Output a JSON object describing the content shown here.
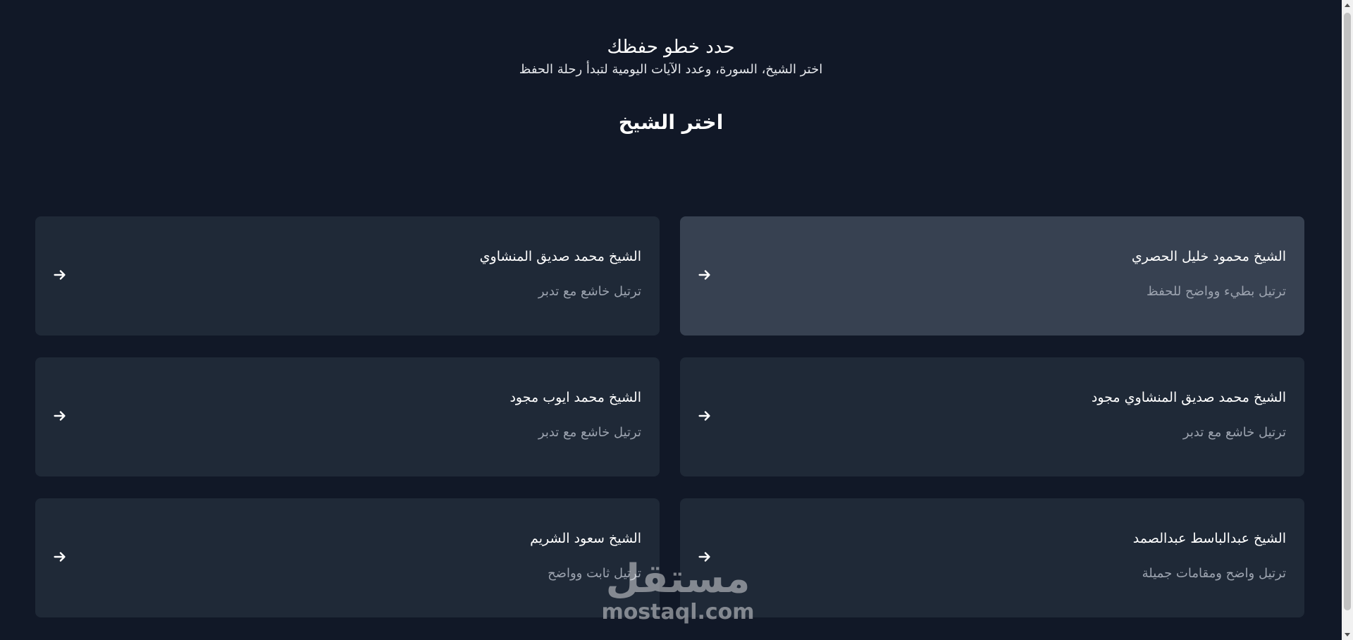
{
  "header": {
    "title": "حدد خطو حفظك",
    "subtitle": "اختر الشيخ، السورة، وعدد الآيات اليومية لتبدأ رحلة الحفظ"
  },
  "section": {
    "title": "اختر الشيخ"
  },
  "sheikhs": [
    {
      "name": "الشيخ محمود خليل الحصري",
      "desc": "ترتيل بطيء وواضح للحفظ",
      "active": true,
      "icon": "arrow-right-icon"
    },
    {
      "name": "الشيخ محمد صديق المنشاوي",
      "desc": "ترتيل خاشع مع تدبر",
      "active": false,
      "icon": "arrow-right-icon"
    },
    {
      "name": "الشيخ محمد صديق المنشاوي مجود",
      "desc": "ترتيل خاشع مع تدبر",
      "active": false,
      "icon": "arrow-right-icon"
    },
    {
      "name": "الشيخ محمد ايوب مجود",
      "desc": "ترتيل خاشع مع تدبر",
      "active": false,
      "icon": "arrow-right-icon"
    },
    {
      "name": "الشيخ عبدالباسط عبدالصمد",
      "desc": "ترتيل واضح ومقامات جميلة",
      "active": false,
      "icon": "arrow-right-icon"
    },
    {
      "name": "الشيخ سعود الشريم",
      "desc": "ترتيل ثابت وواضح",
      "active": false,
      "icon": "arrow-right-icon"
    }
  ],
  "watermark": {
    "logo": "مستقل",
    "domain": "mostaql.com"
  },
  "colors": {
    "background": "#111827",
    "card": "#1f2937",
    "card_active": "#374151",
    "muted_text": "#9ca3af"
  }
}
